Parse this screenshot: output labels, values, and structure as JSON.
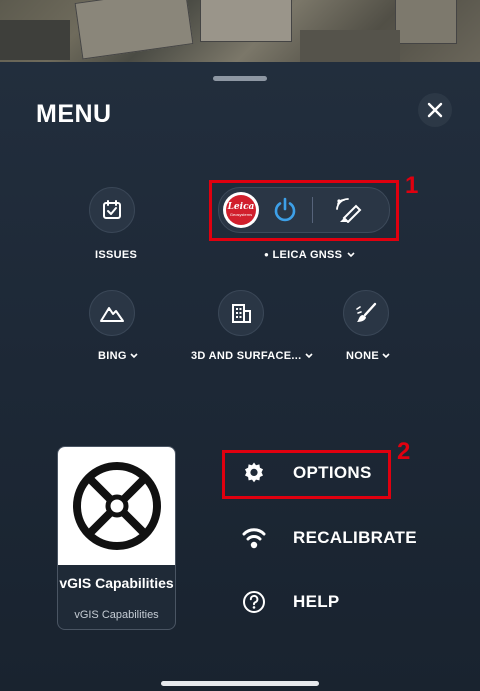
{
  "menu": {
    "title": "MENU"
  },
  "quick_actions": [
    {
      "label": "ISSUES",
      "icon": "calendar-check-icon"
    },
    {
      "label": "LEICA GNSS",
      "icon": "leica-logo-icon"
    },
    {
      "label": "BING",
      "icon": "mountain-icon"
    },
    {
      "label": "3D AND SURFACE...",
      "icon": "building-icon"
    },
    {
      "label": "NONE",
      "icon": "brush-icon"
    }
  ],
  "gnss": {
    "logo_text": "Leica",
    "logo_subtext": "Geosystems",
    "status_dot": "●"
  },
  "annotations": {
    "box1": "1",
    "box2": "2",
    "color": "#e0000f"
  },
  "card": {
    "title": "vGIS Capabilities",
    "subtitle": "vGIS Capabilities"
  },
  "options": [
    {
      "label": "OPTIONS",
      "icon": "gear-icon"
    },
    {
      "label": "RECALIBRATE",
      "icon": "wifi-icon"
    },
    {
      "label": "HELP",
      "icon": "help-icon"
    }
  ],
  "colors": {
    "accent_blue": "#3da0e8",
    "background": "#1c2633"
  }
}
